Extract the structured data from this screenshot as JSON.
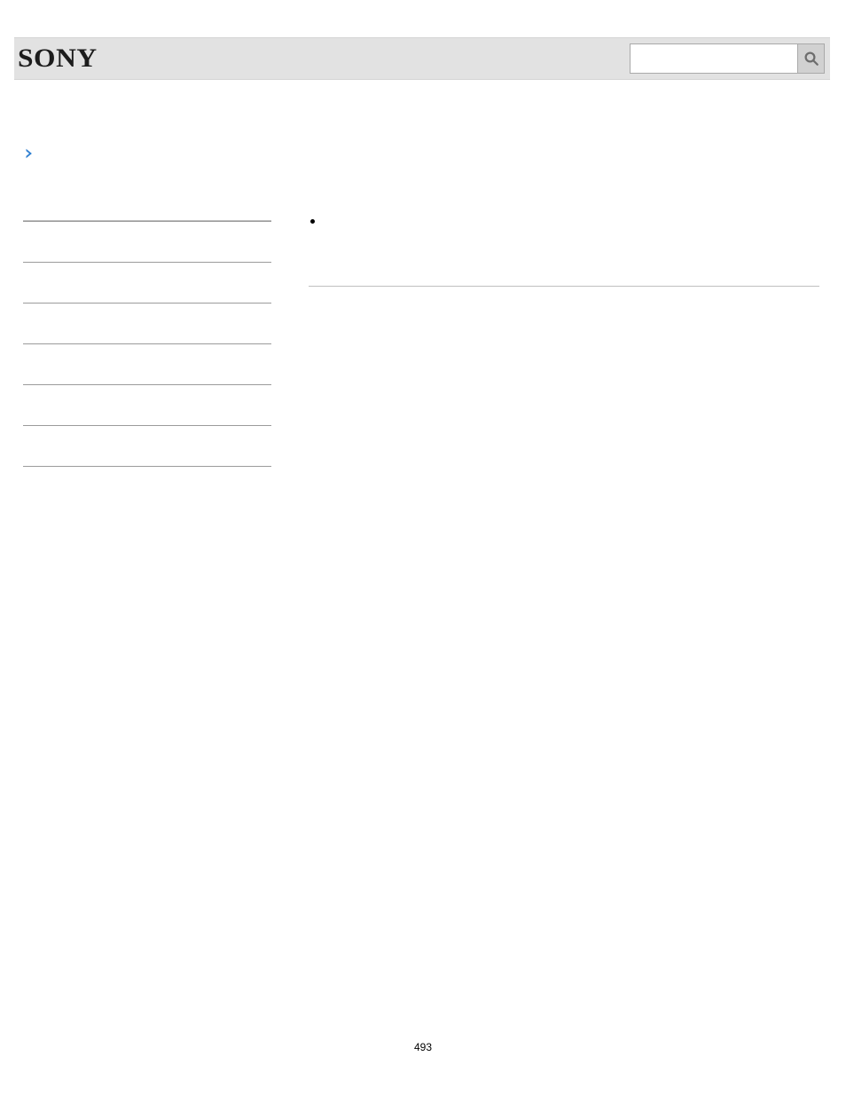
{
  "header": {
    "brand": "SONY",
    "search_value": "",
    "search_placeholder": ""
  },
  "sidebar": {
    "items": [
      {
        "label": ""
      },
      {
        "label": ""
      },
      {
        "label": ""
      },
      {
        "label": ""
      },
      {
        "label": ""
      },
      {
        "label": ""
      },
      {
        "label": ""
      }
    ]
  },
  "main": {
    "bullet_text": ""
  },
  "page_number": "493",
  "colors": {
    "header_bg": "#e2e2e2",
    "accent_blue": "#2f7fd1",
    "rule_gray": "#9b9b9b"
  }
}
